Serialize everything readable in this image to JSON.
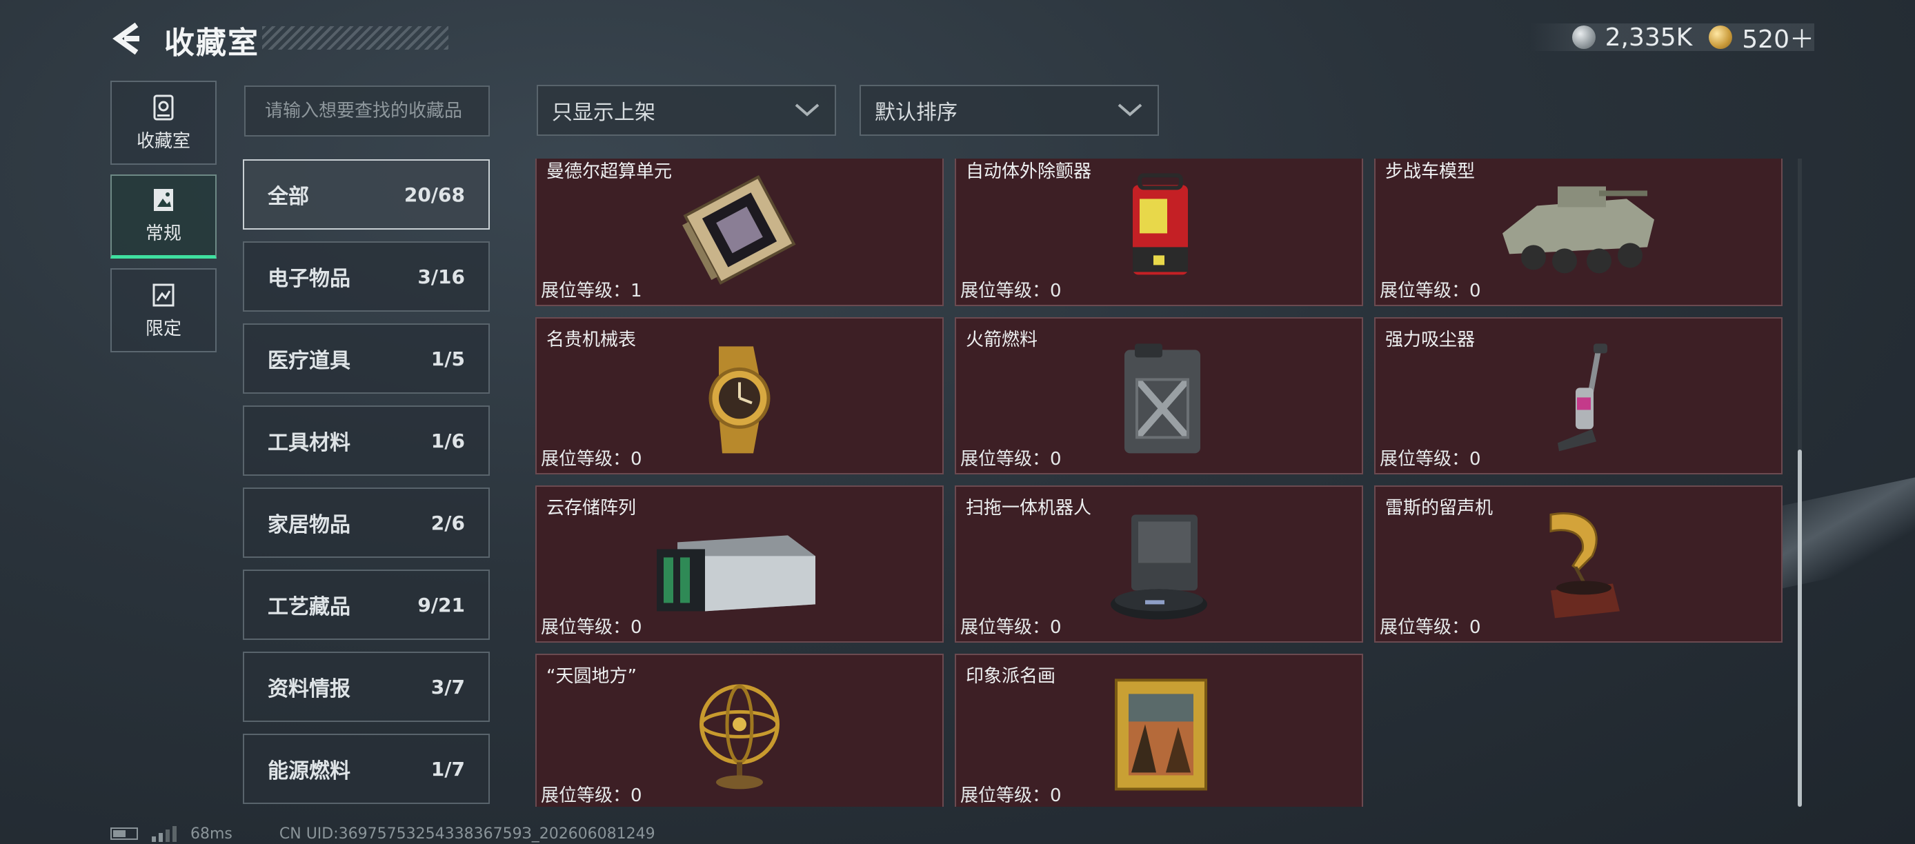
{
  "header": {
    "title": "收藏室",
    "currencies": [
      {
        "icon": "silver-coin-icon",
        "value": "2,335K"
      },
      {
        "icon": "gold-coin-icon",
        "value": "520＋"
      }
    ]
  },
  "sidenav": [
    {
      "label": "收藏室",
      "icon": "vault-icon",
      "active": false
    },
    {
      "label": "常规",
      "icon": "regular-collection-icon",
      "active": true
    },
    {
      "label": "限定",
      "icon": "limited-collection-icon",
      "active": false
    }
  ],
  "search": {
    "placeholder": "请输入想要查找的收藏品",
    "value": ""
  },
  "filters": {
    "shelf": {
      "value": "只显示上架"
    },
    "sort": {
      "value": "默认排序"
    }
  },
  "categories": [
    {
      "label": "全部",
      "count": "20/68",
      "active": true
    },
    {
      "label": "电子物品",
      "count": "3/16"
    },
    {
      "label": "医疗道具",
      "count": "1/5"
    },
    {
      "label": "工具材料",
      "count": "1/6"
    },
    {
      "label": "家居物品",
      "count": "2/6"
    },
    {
      "label": "工艺藏品",
      "count": "9/21"
    },
    {
      "label": "资料情报",
      "count": "3/7"
    },
    {
      "label": "能源燃料",
      "count": "1/7"
    }
  ],
  "items": [
    {
      "name": "曼德尔超算单元",
      "level": "展位等级：1",
      "art": "processor"
    },
    {
      "name": "自动体外除颤器",
      "level": "展位等级：0",
      "art": "defibrillator"
    },
    {
      "name": "步战车模型",
      "level": "展位等级：0",
      "art": "tank"
    },
    {
      "name": "名贵机械表",
      "level": "展位等级：0",
      "art": "watch"
    },
    {
      "name": "火箭燃料",
      "level": "展位等级：0",
      "art": "jerrycan"
    },
    {
      "name": "强力吸尘器",
      "level": "展位等级：0",
      "art": "vacuum"
    },
    {
      "name": "云存储阵列",
      "level": "展位等级：0",
      "art": "server"
    },
    {
      "name": "扫拖一体机器人",
      "level": "展位等级：0",
      "art": "robot"
    },
    {
      "name": "雷斯的留声机",
      "level": "展位等级：0",
      "art": "gramophone"
    },
    {
      "name": "“天圆地方”",
      "level": "展位等级：0",
      "art": "armillary"
    },
    {
      "name": "印象派名画",
      "level": "展位等级：0",
      "art": "painting"
    }
  ],
  "footer": {
    "ping": "68ms",
    "uid": "CN UID:3697575325433836759З_202606081249"
  }
}
